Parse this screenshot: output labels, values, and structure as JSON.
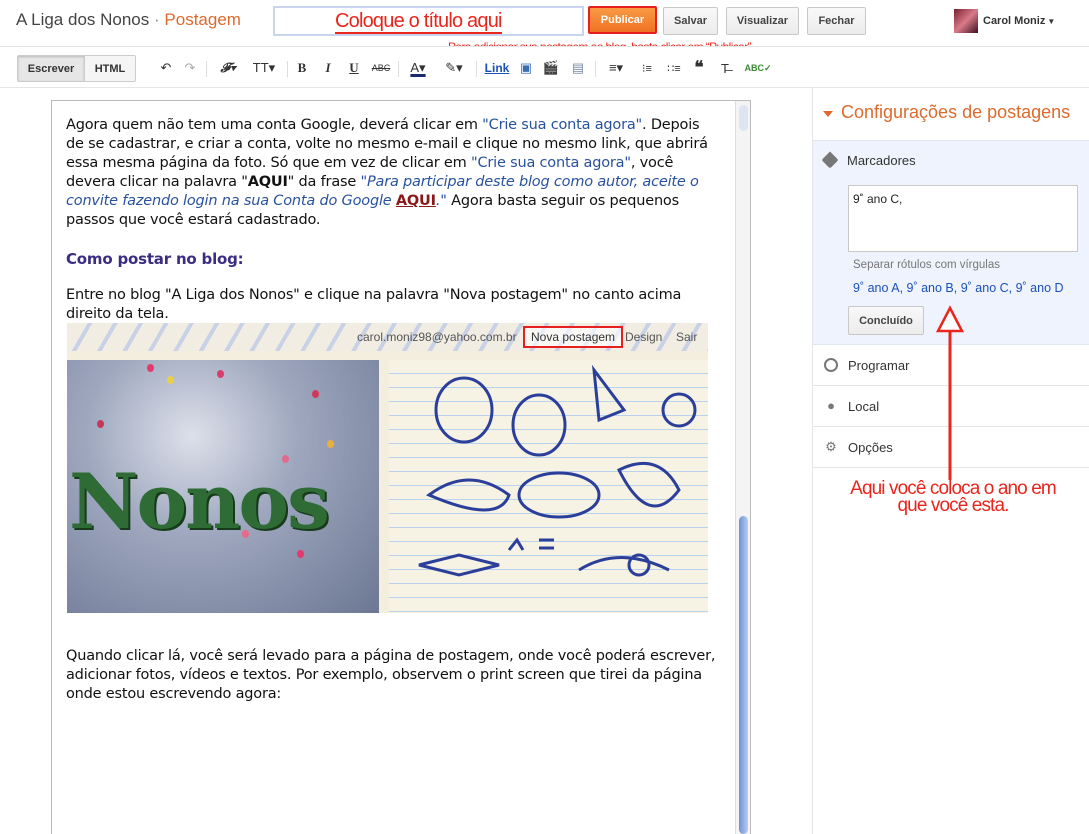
{
  "header": {
    "blog_name": "A Liga dos Nonos",
    "separator": "·",
    "section": "Postagem",
    "title_placeholder": "Coloque o título aqui",
    "publish_label": "Publicar",
    "save_label": "Salvar",
    "preview_label": "Visualizar",
    "close_label": "Fechar",
    "publish_note": "Para adicionar sua postagem ao blog, basta clicar em “Publicar”",
    "user_name": "Carol Moniz"
  },
  "toolbar": {
    "mode_write": "Escrever",
    "mode_html": "HTML",
    "undo_icon": "↶",
    "redo_icon": "↷",
    "font_icon": "𝓕▾",
    "size_icon": "TT▾",
    "bold": "B",
    "italic": "I",
    "underline": "U",
    "strike": "ABC",
    "text_color": "A▾",
    "highlight": "✎▾",
    "link": "Link",
    "image_icon": "▣",
    "video_icon": "🎬",
    "jump_break_icon": "▤",
    "align": "≡▾",
    "numbered_list": "⁝≡",
    "bullet_list": "∷≡",
    "quote": "❝",
    "clear_format": "T̶",
    "spellcheck": "ABC✓"
  },
  "content": {
    "p1_a": "Agora quem não tem uma conta Google, deverá clicar em ",
    "p1_link1": "\"Crie sua conta agora\"",
    "p1_b": ". Depois de se cadastrar, e criar a conta, volte no mesmo e-mail e clique no mesmo link, que abrirá essa mesma página da foto. Só que em vez de clicar em ",
    "p1_link2": "\"Crie sua conta agora\"",
    "p1_c": ", você devera clicar na palavra \"",
    "p1_aqui_bold": "AQUI",
    "p1_d": "\" da frase ",
    "p1_italic": "\"Para participar deste blog como autor, aceite o convite fazendo login na sua Conta do Google ",
    "p1_aqui_link": "AQUI",
    "p1_italic_end": ".\"",
    "p1_e": "  Agora basta seguir os pequenos passos que você estará cadastrado.",
    "heading": "Como postar no blog:",
    "p2": "Entre no blog \"A Liga dos Nonos\" e clique na palavra \"Nova postagem\" no canto acima direito da tela.",
    "p3": "Quando clicar lá, você será levado para a página de postagem, onde você poderá escrever, adicionar fotos, vídeos e textos. Por exemplo, observem o print screen que tirei da página onde estou escrevendo agora:"
  },
  "screenshot": {
    "email": "carol.moniz98@yahoo.com.br",
    "nova_postagem": "Nova postagem",
    "design": "Design",
    "sair": "Sair",
    "nonos": "Nonos"
  },
  "sidebar": {
    "heading": "Configurações de postagens",
    "labels_title": "Marcadores",
    "labels_value": "9˚ ano C,",
    "labels_hint": "Separar rótulos com vírgulas",
    "suggestions": "9˚ ano A,  9˚ ano B,  9˚ ano C,  9˚ ano D",
    "done_label": "Concluído",
    "schedule": "Programar",
    "location": "Local",
    "options": "Opções"
  },
  "annotation": {
    "text": "Aqui você coloca o ano em que você esta."
  },
  "colors": {
    "accent_orange": "#dd6a2c",
    "annotation_red": "#e8261d",
    "link_blue": "#29529c",
    "heading_purple": "#3b2d83"
  }
}
